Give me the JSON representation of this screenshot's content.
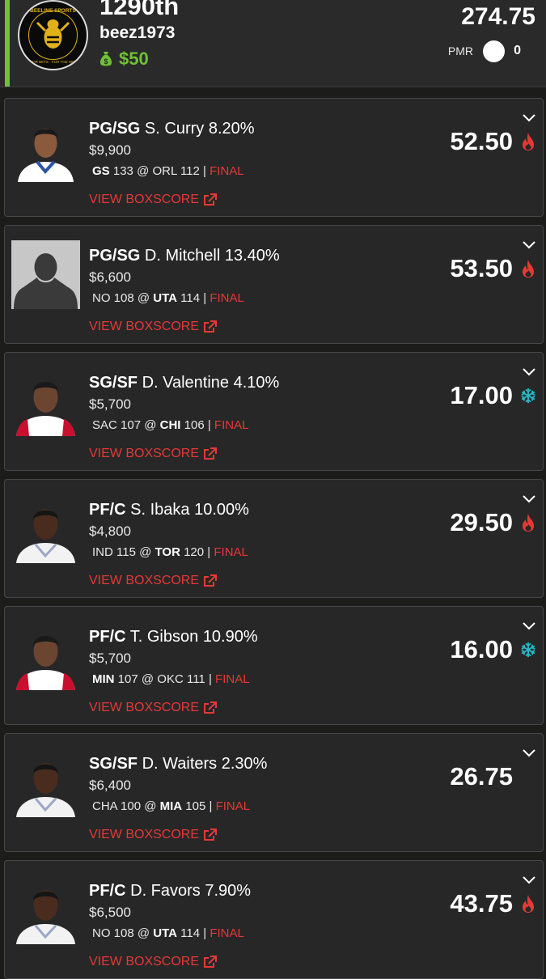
{
  "header": {
    "rank": "1290th",
    "username": "beez1973",
    "balance": "$50",
    "total_points": "274.75",
    "pmr_label": "PMR",
    "pmr_value": "0",
    "logo_text_top": "BEELINE SPORTS",
    "logo_text_bottom": "FOR BETS · FOR THE WIN"
  },
  "colors": {
    "accent": "#6fc234",
    "final": "#e53935",
    "hot": "#e53935",
    "cold": "#2ab7c9"
  },
  "box_score_label": "VIEW BOXSCORE",
  "players": [
    {
      "pos": "PG/SG",
      "name": "S. Curry",
      "own": "8.20%",
      "salary": "$9,900",
      "away": "GS",
      "away_score": "133",
      "at": "@",
      "home": "ORL",
      "home_score": "112",
      "bold": "away",
      "sep": "|",
      "status": "FINAL",
      "points": "52.50",
      "icon": "flame-icon",
      "avatar": "photo-dark"
    },
    {
      "pos": "PG/SG",
      "name": "D. Mitchell",
      "own": "13.40%",
      "salary": "$6,600",
      "away": "NO",
      "away_score": "108",
      "at": "@",
      "home": "UTA",
      "home_score": "114",
      "bold": "home",
      "sep": "|",
      "status": "FINAL",
      "points": "53.50",
      "icon": "flame-icon",
      "avatar": "placeholder"
    },
    {
      "pos": "SG/SF",
      "name": "D. Valentine",
      "own": "4.10%",
      "salary": "$5,700",
      "away": "SAC",
      "away_score": "107",
      "at": "@",
      "home": "CHI",
      "home_score": "106",
      "bold": "home",
      "sep": "|",
      "status": "FINAL",
      "points": "17.00",
      "icon": "snowflake-icon",
      "avatar": "photo-red"
    },
    {
      "pos": "PF/C",
      "name": "S. Ibaka",
      "own": "10.00%",
      "salary": "$4,800",
      "away": "IND",
      "away_score": "115",
      "at": "@",
      "home": "TOR",
      "home_score": "120",
      "bold": "home",
      "sep": "|",
      "status": "FINAL",
      "points": "29.50",
      "icon": "flame-icon",
      "avatar": "photo-white"
    },
    {
      "pos": "PF/C",
      "name": "T. Gibson",
      "own": "10.90%",
      "salary": "$5,700",
      "away": "MIN",
      "away_score": "107",
      "at": "@",
      "home": "OKC",
      "home_score": "111",
      "bold": "away",
      "sep": "|",
      "status": "FINAL",
      "points": "16.00",
      "icon": "snowflake-icon",
      "avatar": "photo-red"
    },
    {
      "pos": "SG/SF",
      "name": "D. Waiters",
      "own": "2.30%",
      "salary": "$6,400",
      "away": "CHA",
      "away_score": "100",
      "at": "@",
      "home": "MIA",
      "home_score": "105",
      "bold": "home",
      "sep": "|",
      "status": "FINAL",
      "points": "26.75",
      "icon": "",
      "avatar": "photo-white"
    },
    {
      "pos": "PF/C",
      "name": "D. Favors",
      "own": "7.90%",
      "salary": "$6,500",
      "away": "NO",
      "away_score": "108",
      "at": "@",
      "home": "UTA",
      "home_score": "114",
      "bold": "home",
      "sep": "|",
      "status": "FINAL",
      "points": "43.75",
      "icon": "flame-icon",
      "avatar": "photo-white"
    }
  ]
}
